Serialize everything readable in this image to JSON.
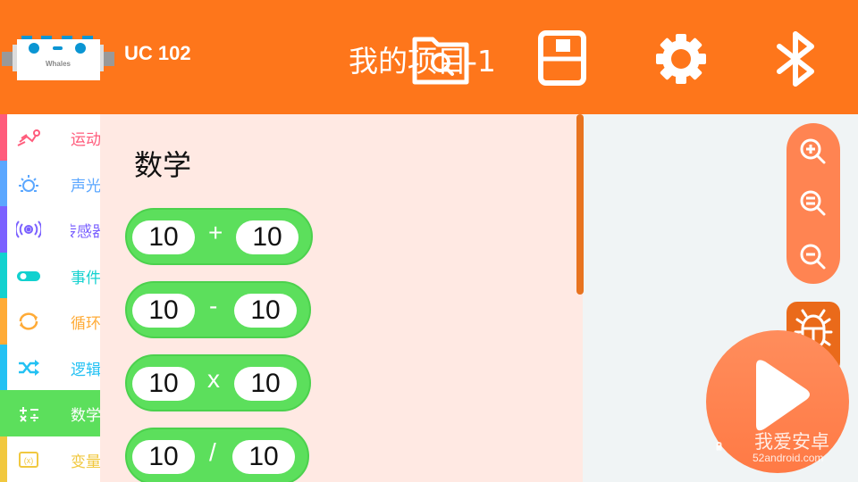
{
  "header": {
    "device_name": "UC 102",
    "logo_text": "Whales",
    "project_title": "我的项目-1",
    "buttons": {
      "open": "folder-search-icon",
      "save": "save-icon",
      "settings": "gear-icon",
      "bluetooth": "bluetooth-icon"
    },
    "colors": {
      "background": "#fe761b"
    }
  },
  "sidebar": {
    "items": [
      {
        "label": "运动",
        "icon": "running-icon",
        "color": "#ff5c7c"
      },
      {
        "label": "声光",
        "icon": "light-icon",
        "color": "#5ba7ff"
      },
      {
        "label": "传感器",
        "icon": "sensor-icon",
        "color": "#7b61ff"
      },
      {
        "label": "事件",
        "icon": "toggle-icon",
        "color": "#12d1cf"
      },
      {
        "label": "循环",
        "icon": "loop-icon",
        "color": "#ffab37"
      },
      {
        "label": "逻辑",
        "icon": "shuffle-icon",
        "color": "#24c1f3"
      },
      {
        "label": "数学",
        "icon": "math-icon",
        "color": "#5cdf5c",
        "active": true
      },
      {
        "label": "变量",
        "icon": "variable-icon",
        "color": "#f1c83f"
      }
    ]
  },
  "flyout": {
    "title": "数学",
    "blocks": [
      {
        "left": "10",
        "op": "+",
        "right": "10"
      },
      {
        "left": "10",
        "op": "-",
        "right": "10"
      },
      {
        "left": "10",
        "op": "x",
        "right": "10"
      },
      {
        "left": "10",
        "op": "/",
        "right": "10"
      }
    ]
  },
  "canvas_controls": {
    "zoom_in": "zoom-in-icon",
    "zoom_reset": "zoom-reset-icon",
    "zoom_out": "zoom-out-icon",
    "debug": "bug-icon",
    "run": "play-icon"
  },
  "watermark": {
    "text": "我爱安卓",
    "url": "52android.com"
  }
}
